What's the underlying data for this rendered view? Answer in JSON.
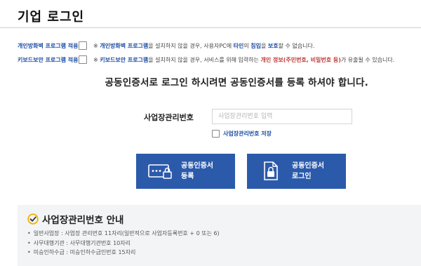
{
  "page": {
    "title": "기업 로그인"
  },
  "options": [
    {
      "label": "개인방화벽 프로그램 적용",
      "notice": [
        {
          "t": "※ ",
          "s": "n"
        },
        {
          "t": "개인방화벽 프로그램",
          "s": "hl"
        },
        {
          "t": "을 설치하지 않을 경우, 사용자PC에 ",
          "s": "n"
        },
        {
          "t": "타인",
          "s": "hl"
        },
        {
          "t": "의 ",
          "s": "n"
        },
        {
          "t": "침입",
          "s": "hl"
        },
        {
          "t": "을 ",
          "s": "n"
        },
        {
          "t": "보호",
          "s": "hl"
        },
        {
          "t": "할 수 없습니다.",
          "s": "n"
        }
      ]
    },
    {
      "label": "키보드보안 프로그램 적용",
      "notice": [
        {
          "t": "※ ",
          "s": "n"
        },
        {
          "t": "키보드보안 프로그램",
          "s": "hl"
        },
        {
          "t": "을 설치하지 않을 경우, 서비스를 위해 입력하는 ",
          "s": "n"
        },
        {
          "t": "개인 정보(주민번호, 비밀번호 등)",
          "s": "hr"
        },
        {
          "t": "가 유출될 수 있습니다.",
          "s": "n"
        }
      ]
    }
  ],
  "headline": "공동인증서로 로그인 하시려면 공동인증서를 등록 하셔야 합니다.",
  "form": {
    "label": "사업장관리번호",
    "value": "",
    "placeholder": "사업장관리번호 입력",
    "save_label": "사업장관리번호 저장"
  },
  "buttons": {
    "register": {
      "line1": "공동인증서",
      "line2": "등록"
    },
    "login": {
      "line1": "공동인증서",
      "line2": "로그인"
    }
  },
  "info": {
    "title": "사업장관리번호 안내",
    "items": [
      "일반사업장 : 사업장 관리번호 11자리(일반적으로 사업자등록번호 + 0 또는 6)",
      "사무대행기관 : 사무대행기관번호 10자리",
      "미승인하수급 : 미승인하수급인번호 15자리"
    ]
  },
  "colors": {
    "accent": "#2c5aab",
    "link": "#1f4fa3",
    "warn": "#c23b3b",
    "check": "#f2b400"
  },
  "icons": {
    "register": "certificate-password-icon",
    "login": "certificate-lock-icon",
    "title": "check-circle-icon"
  }
}
